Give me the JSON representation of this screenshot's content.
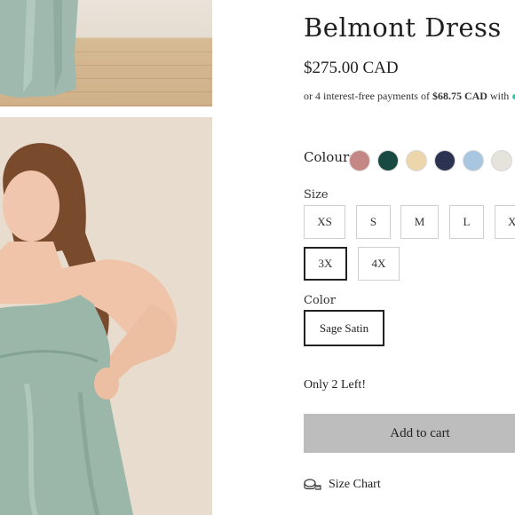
{
  "product": {
    "title": "Belmont Dress",
    "price": "$275.00 CAD",
    "installments": {
      "prefix": "or 4 interest-free payments of ",
      "amount": "$68.75 CAD",
      "suffix": " with"
    }
  },
  "colours": {
    "label": "Colours",
    "swatches": [
      {
        "name": "dusty-rose",
        "color": "#c48784"
      },
      {
        "name": "emerald",
        "color": "#184a42"
      },
      {
        "name": "champagne",
        "color": "#edd6ac"
      },
      {
        "name": "navy",
        "color": "#2c3350"
      },
      {
        "name": "light-blue",
        "color": "#a9c6e0"
      },
      {
        "name": "ivory",
        "color": "#e6e2dc"
      }
    ]
  },
  "size": {
    "label": "Size",
    "options": [
      "XS",
      "S",
      "M",
      "L",
      "X",
      "3X",
      "4X"
    ],
    "selected": "3X"
  },
  "color": {
    "label": "Color",
    "selected": "Sage Satin"
  },
  "stock_text": "Only 2 Left!",
  "cart_button": "Add to cart",
  "size_chart_link": "Size Chart"
}
